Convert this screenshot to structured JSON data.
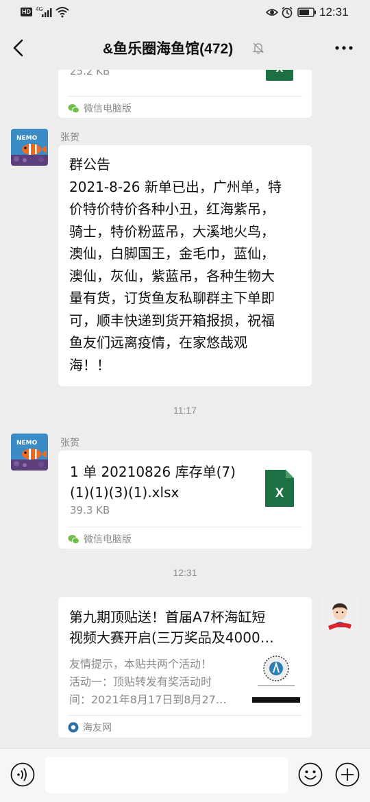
{
  "status_bar": {
    "hd": "HD",
    "network": "4G",
    "time": "12:31"
  },
  "header": {
    "title": "&鱼乐圈海鱼馆(472)"
  },
  "messages": {
    "prev_file": {
      "size": "25.2 KB",
      "source": "微信电脑版"
    },
    "notice": {
      "sender": "张贺",
      "heading": "群公告",
      "lines": [
        "2021-8-26 新单已出，广州单，特",
        "价特价特价各种小丑，红海紫吊，",
        "骑士，特价粉蓝吊，大溪地火鸟，",
        "澳仙，白脚国王，金毛巾，蓝仙，",
        "澳仙，灰仙，紫蓝吊，各种生物大",
        "量有货，订货鱼友私聊群主下单即",
        "可，顺丰快递到货开箱报损，祝福",
        "鱼友们远离疫情，在家悠哉观",
        "海！！"
      ]
    },
    "time1": "11:17",
    "file": {
      "sender": "张贺",
      "name_line1": "1 单 20210826 库存单(7)",
      "name_line2": "(1)(1)(3)(1).xlsx",
      "size": "39.3 KB",
      "source": "微信电脑版",
      "icon_letter": "X"
    },
    "time2": "12:31",
    "link": {
      "title_line1": "第九期顶贴送！首届A7杯海缸短",
      "title_line2": "视频大赛开启(三万奖品及4000…",
      "desc_line1": "友情提示，本贴共两个活动！",
      "desc_line2": "活动一：顶贴转发有奖活动时",
      "desc_line3": "间：2021年8月17日到8月27…",
      "source": "海友网"
    }
  },
  "colors": {
    "background": "#ededed",
    "bubble": "#ffffff",
    "excel_green": "#1d7044",
    "wechat_green": "#6fbf4a"
  }
}
